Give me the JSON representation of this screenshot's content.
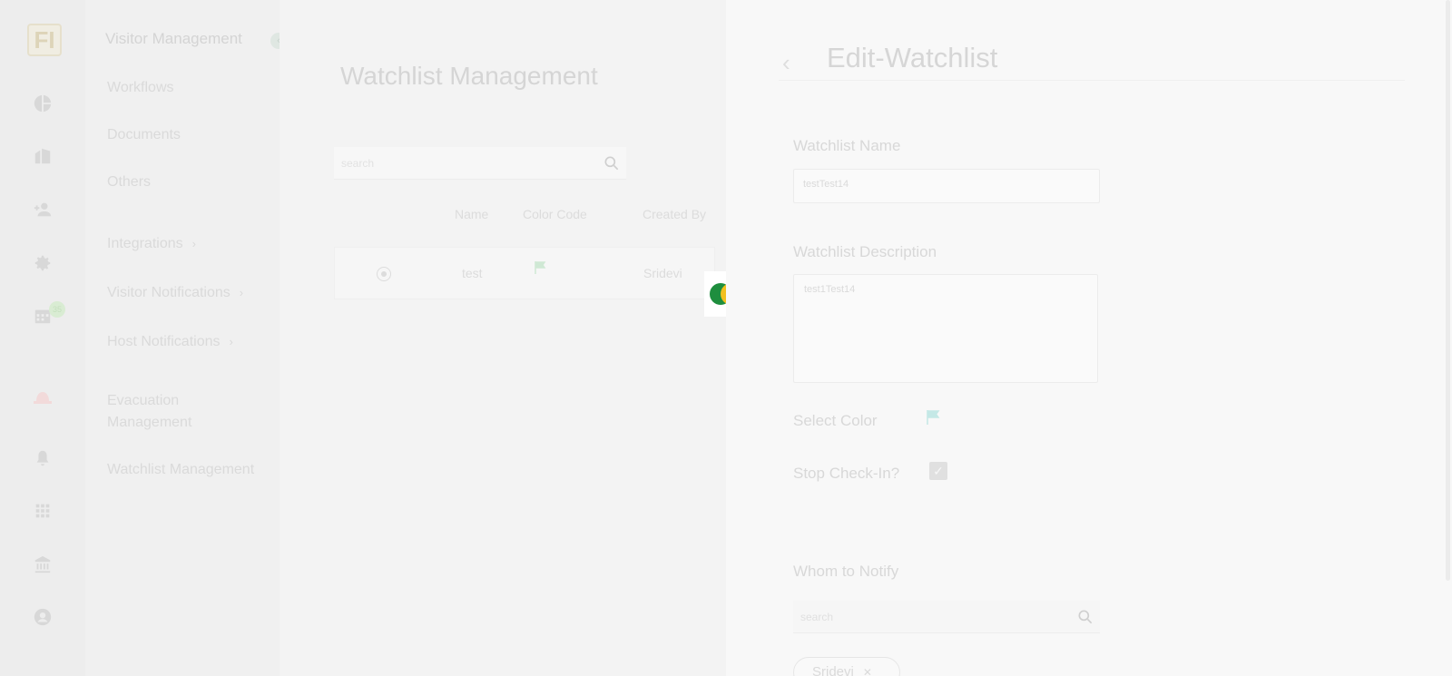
{
  "rail": {
    "logo": "FI",
    "icons": [
      "pie-chart-icon",
      "building-icon",
      "add-person-icon",
      "gear-icon",
      "calendar-icon",
      "alarm-icon",
      "bell-icon",
      "grid-icon",
      "bank-icon",
      "account-icon"
    ],
    "badge": "35"
  },
  "subnav": {
    "header": "Visitor Management",
    "items": [
      {
        "label": "Workflows"
      },
      {
        "label": "Documents"
      },
      {
        "label": "Others"
      },
      {
        "label": "Integrations"
      },
      {
        "label": "Visitor Notifications"
      },
      {
        "label": "Host Notifications"
      },
      {
        "label": "Evacuation Management"
      },
      {
        "label": "Watchlist Management"
      }
    ]
  },
  "main": {
    "title": "Watchlist Management",
    "search_placeholder": "search",
    "columns": [
      "Name",
      "Color Code",
      "Created By"
    ],
    "row": {
      "name": "test",
      "created_by": "Sridevi"
    }
  },
  "panel": {
    "title": "Edit-Watchlist",
    "name_label": "Watchlist Name",
    "name_value": "testTest14",
    "desc_label": "Watchlist Description",
    "desc_value": "test1Test14",
    "color_label": "Select Color",
    "flag_color": "#c4e8e6",
    "stopcheck_label": "Stop Check-In?",
    "stopcheck_checked": true,
    "notify_label": "Whom to Notify",
    "notify_placeholder": "search",
    "chip_label": "Sridevi"
  },
  "colors": {
    "loader_green": "#1e8e3e",
    "loader_yellow": "#f2c01e"
  }
}
